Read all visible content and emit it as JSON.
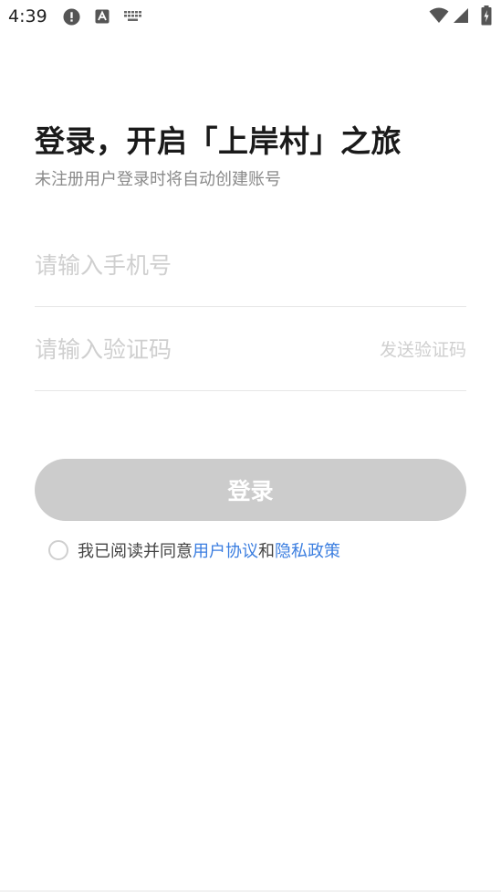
{
  "status_bar": {
    "time": "4:39",
    "icons": [
      "alert-icon",
      "a-icon",
      "keyboard-icon",
      "wifi-icon",
      "signal-icon",
      "battery-icon"
    ]
  },
  "header": {
    "title": "登录，开启「上岸村」之旅",
    "subtitle": "未注册用户登录时将自动创建账号"
  },
  "form": {
    "phone_placeholder": "请输入手机号",
    "code_placeholder": "请输入验证码",
    "send_code_label": "发送验证码",
    "login_label": "登录"
  },
  "agreement": {
    "prefix": "我已阅读并同意",
    "user_agreement": "用户协议",
    "and": "和",
    "privacy_policy": "隐私政策",
    "checked": false
  },
  "colors": {
    "link": "#3b7ee0",
    "button_disabled": "#cccccc",
    "placeholder": "#cfcfcf"
  }
}
